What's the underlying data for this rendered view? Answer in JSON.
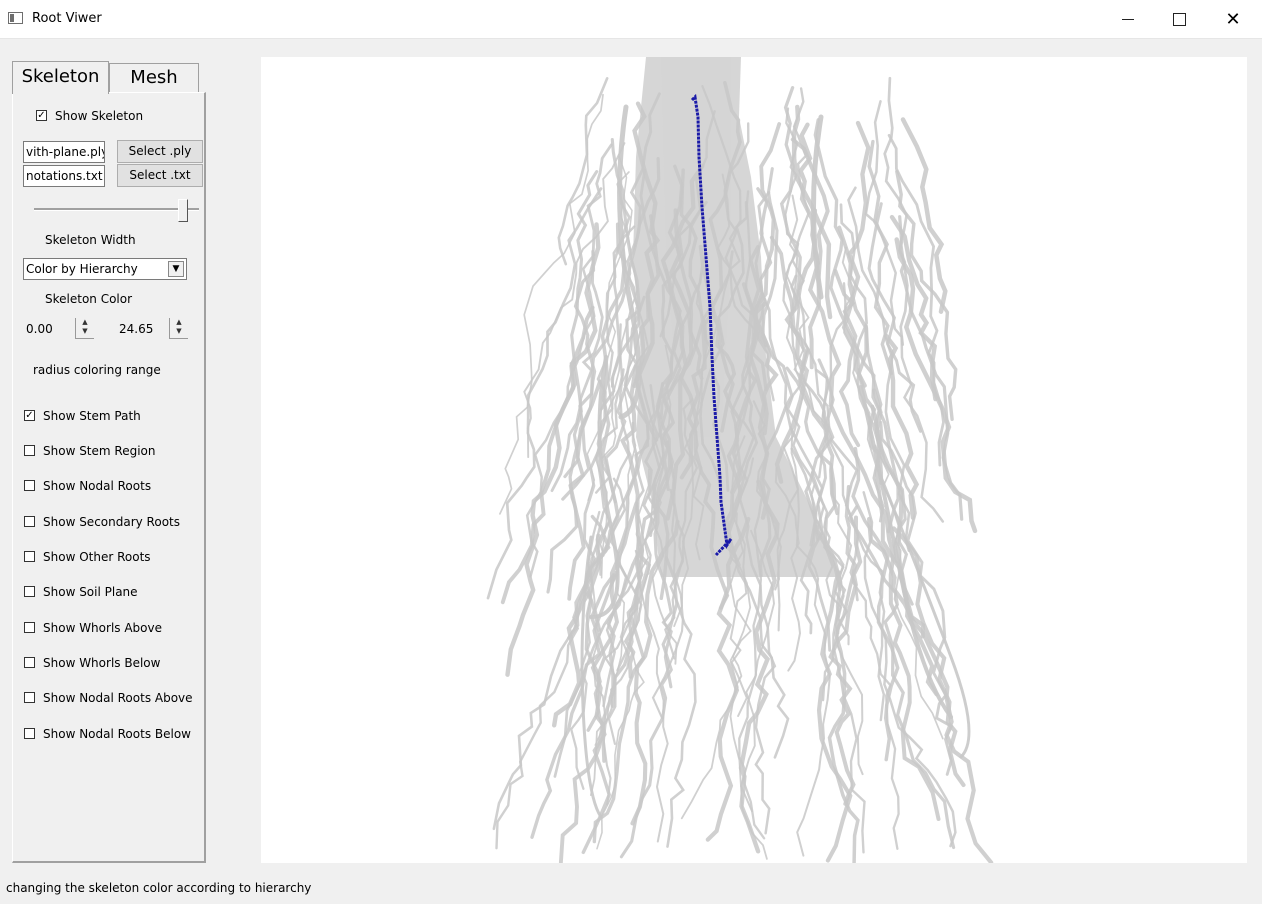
{
  "window": {
    "title": "Root Viwer",
    "close_symbol": "✕"
  },
  "tabs": [
    {
      "label": "Skeleton"
    },
    {
      "label": "Mesh"
    }
  ],
  "skeleton": {
    "show_skeleton": {
      "label": "Show Skeleton",
      "checked": true
    },
    "ply_file": {
      "value": "vith-plane.ply",
      "button": "Select .ply"
    },
    "txt_file": {
      "value": "notations.txt",
      "button": "Select .txt"
    },
    "width_slider": {
      "level": 0.93,
      "label": "Skeleton Width"
    },
    "color_mode": {
      "selected": "Color by Hierarchy",
      "label": "Skeleton Color"
    },
    "range_min": "0.00",
    "range_max": "24.65",
    "range_label": "radius coloring range",
    "checkboxes": [
      {
        "label": "Show Stem Path",
        "checked": true
      },
      {
        "label": "Show Stem Region",
        "checked": false
      },
      {
        "label": "Show Nodal Roots",
        "checked": false
      },
      {
        "label": "Show Secondary Roots",
        "checked": false
      },
      {
        "label": "Show Other Roots",
        "checked": false
      },
      {
        "label": "Show Soil Plane",
        "checked": false
      },
      {
        "label": "Show Whorls Above",
        "checked": false
      },
      {
        "label": "Show Whorls Below",
        "checked": false
      },
      {
        "label": "Show Nodal Roots Above",
        "checked": false
      },
      {
        "label": "Show Nodal Roots Below",
        "checked": false
      }
    ]
  },
  "colors": {
    "mesh": "#c8c8c8",
    "stem_path": "#1a1aa8"
  },
  "status": "changing the skeleton color according to hierarchy"
}
